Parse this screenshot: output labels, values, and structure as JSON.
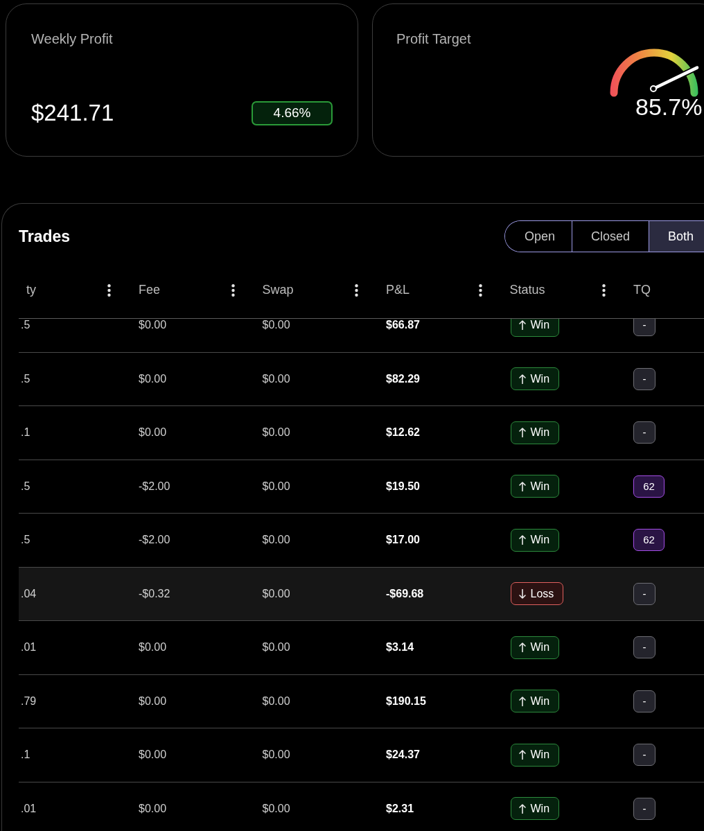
{
  "cards": [
    {
      "kind": "value",
      "title": "Weekly Profit",
      "value": "$241.71",
      "badge": "4.66%"
    },
    {
      "kind": "gauge",
      "title": "Profit Target",
      "level": 0.857,
      "reading": "85.7%"
    }
  ],
  "trades": {
    "title": "Trades",
    "filters": [
      {
        "label": "Open",
        "selected": false
      },
      {
        "label": "Closed",
        "selected": false
      },
      {
        "label": "Both",
        "selected": true
      }
    ],
    "columns": [
      {
        "label": "ty",
        "menu": true
      },
      {
        "label": "Fee",
        "menu": true
      },
      {
        "label": "Swap",
        "menu": true
      },
      {
        "label": "P&L",
        "menu": true
      },
      {
        "label": "Status",
        "menu": true
      },
      {
        "label": "TQ",
        "menu": false
      }
    ],
    "rows": [
      {
        "column_1": ".5",
        "fee": "$0.00",
        "swap": "$0.00",
        "pnl": "$66.87",
        "status": {
          "kind": "win",
          "label": "Win"
        },
        "tq": {
          "kind": "empty",
          "label": "-"
        },
        "highlighted": false
      },
      {
        "column_1": ".5",
        "fee": "$0.00",
        "swap": "$0.00",
        "pnl": "$82.29",
        "status": {
          "kind": "win",
          "label": "Win"
        },
        "tq": {
          "kind": "empty",
          "label": "-"
        },
        "highlighted": false
      },
      {
        "column_1": ".1",
        "fee": "$0.00",
        "swap": "$0.00",
        "pnl": "$12.62",
        "status": {
          "kind": "win",
          "label": "Win"
        },
        "tq": {
          "kind": "empty",
          "label": "-"
        },
        "highlighted": false
      },
      {
        "column_1": ".5",
        "fee": "-$2.00",
        "swap": "$0.00",
        "pnl": "$19.50",
        "status": {
          "kind": "win",
          "label": "Win"
        },
        "tq": {
          "kind": "score",
          "label": "62"
        },
        "highlighted": false
      },
      {
        "column_1": ".5",
        "fee": "-$2.00",
        "swap": "$0.00",
        "pnl": "$17.00",
        "status": {
          "kind": "win",
          "label": "Win"
        },
        "tq": {
          "kind": "score",
          "label": "62"
        },
        "highlighted": false
      },
      {
        "column_1": ".04",
        "fee": "-$0.32",
        "swap": "$0.00",
        "pnl": "-$69.68",
        "status": {
          "kind": "loss",
          "label": "Loss"
        },
        "tq": {
          "kind": "empty",
          "label": "-"
        },
        "highlighted": true
      },
      {
        "column_1": ".01",
        "fee": "$0.00",
        "swap": "$0.00",
        "pnl": "$3.14",
        "status": {
          "kind": "win",
          "label": "Win"
        },
        "tq": {
          "kind": "empty",
          "label": "-"
        },
        "highlighted": false
      },
      {
        "column_1": ".79",
        "fee": "$0.00",
        "swap": "$0.00",
        "pnl": "$190.15",
        "status": {
          "kind": "win",
          "label": "Win"
        },
        "tq": {
          "kind": "empty",
          "label": "-"
        },
        "highlighted": false
      },
      {
        "column_1": ".1",
        "fee": "$0.00",
        "swap": "$0.00",
        "pnl": "$24.37",
        "status": {
          "kind": "win",
          "label": "Win"
        },
        "tq": {
          "kind": "empty",
          "label": "-"
        },
        "highlighted": false
      },
      {
        "column_1": ".01",
        "fee": "$0.00",
        "swap": "$0.00",
        "pnl": "$2.31",
        "status": {
          "kind": "win",
          "label": "Win"
        },
        "tq": {
          "kind": "empty",
          "label": "-"
        },
        "highlighted": false
      }
    ]
  }
}
